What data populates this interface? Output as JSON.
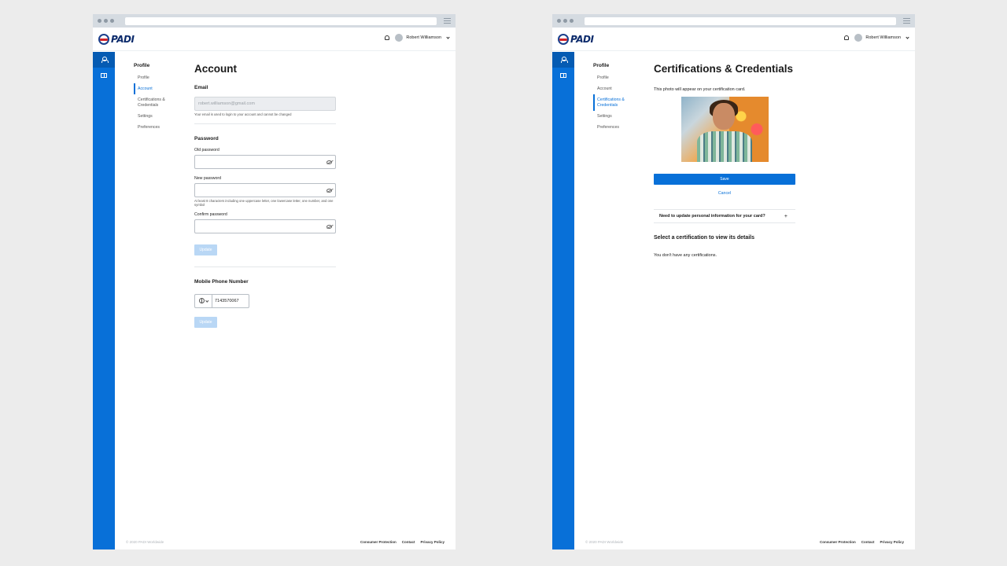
{
  "brand": {
    "logo_text": "PADI",
    "accent": "#0870d8"
  },
  "header": {
    "user_name": "Robert Williamson",
    "bell_icon": "bell-icon"
  },
  "subnav": {
    "title": "Profile",
    "items": [
      {
        "label": "Profile"
      },
      {
        "label": "Account"
      },
      {
        "label": "Certifications &\nCredentials"
      },
      {
        "label": "Settings"
      },
      {
        "label": "Preferences"
      }
    ]
  },
  "account": {
    "title": "Account",
    "email": {
      "heading": "Email",
      "value": "robert.williamson@gmail.com",
      "helper": "Your email is used to login to your account and cannot be changed"
    },
    "password": {
      "heading": "Password",
      "old_label": "Old password",
      "new_label": "New password",
      "new_helper": "At least 8 characters including one uppercase letter, one lowercase letter, one number, and one symbol",
      "confirm_label": "Confirm password",
      "update_label": "Update"
    },
    "phone": {
      "heading": "Mobile Phone Number",
      "value": "7143570067",
      "update_label": "Update"
    }
  },
  "certifications": {
    "title": "Certifications & Credentials",
    "photo_note": "This photo will appear on your certification card.",
    "save_label": "Save",
    "cancel_label": "Cancel",
    "accordion_label": "Need to update personal information for your card?",
    "select_heading": "Select a certification to view its details",
    "empty_text": "You don't have any certifications."
  },
  "footer": {
    "copyright": "© 2020 PADI Worldwide",
    "links": [
      "Consumer Protection",
      "Contact",
      "Privacy Policy"
    ]
  }
}
